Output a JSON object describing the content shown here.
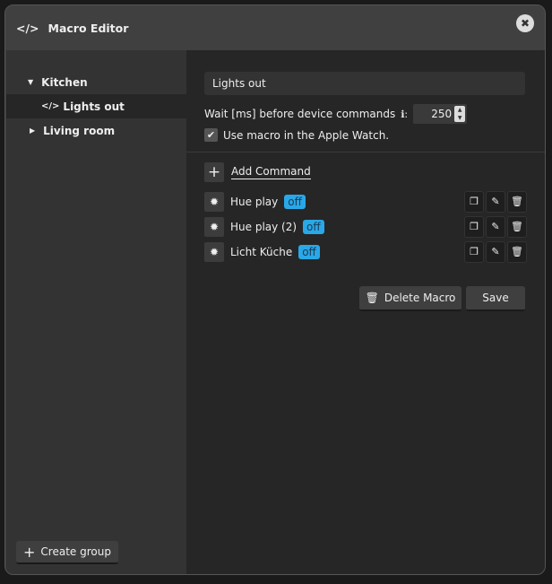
{
  "header": {
    "title": "Macro Editor",
    "icon": "code-icon",
    "close_icon": "close-icon"
  },
  "sidebar": {
    "groups": [
      {
        "label": "Kitchen",
        "expanded": true,
        "items": [
          {
            "label": "Lights out",
            "selected": true
          }
        ]
      },
      {
        "label": "Living room",
        "expanded": false
      }
    ],
    "create_group_label": "Create group"
  },
  "editor": {
    "macro_name": "Lights out",
    "wait_label": "Wait [ms] before device commands",
    "wait_value": "250",
    "apple_watch_label": "Use macro in the Apple Watch.",
    "apple_watch_checked": true,
    "add_command_label": "Add Command",
    "commands": [
      {
        "name": "Hue play",
        "state": "off"
      },
      {
        "name": "Hue play (2)",
        "state": "off"
      },
      {
        "name": "Licht Küche",
        "state": "off"
      }
    ],
    "delete_label": "Delete Macro",
    "save_label": "Save"
  },
  "colors": {
    "badge": "#29a8e8"
  }
}
